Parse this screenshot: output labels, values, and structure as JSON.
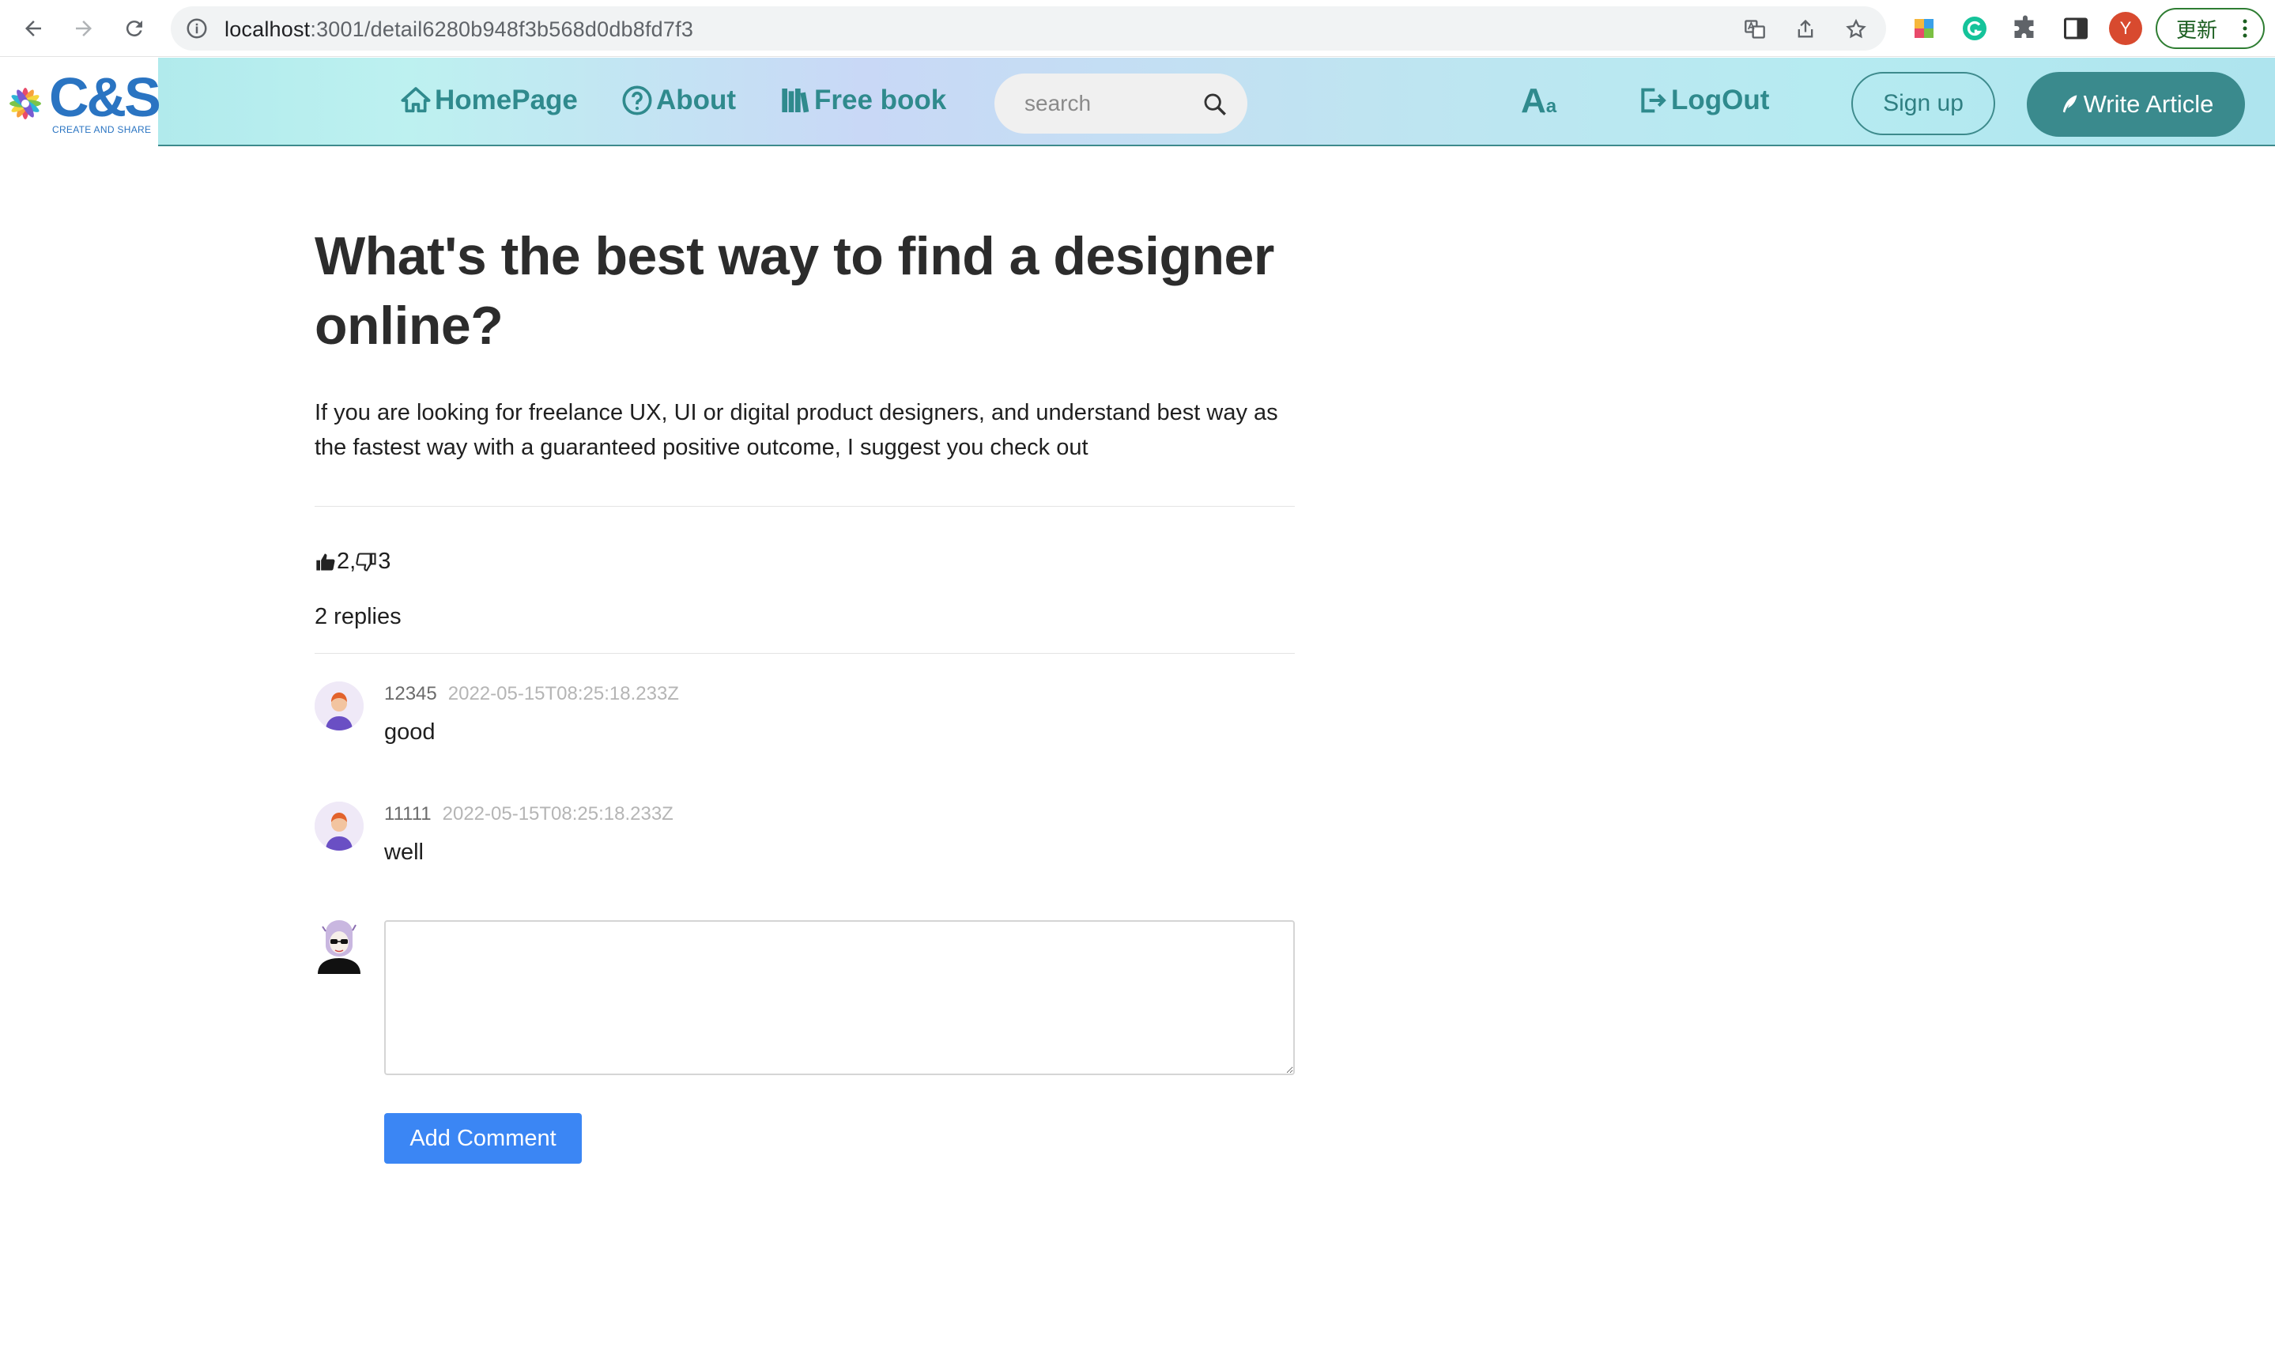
{
  "browser": {
    "url_host": "localhost",
    "url_path": ":3001/detail6280b948f3b568d0db8fd7f3",
    "profile_initial": "Y",
    "update_label": "更新"
  },
  "header": {
    "logo_text": "C&S",
    "logo_subtitle": "CREATE AND SHARE",
    "nav": [
      {
        "label": "HomePage",
        "icon": "home-icon"
      },
      {
        "label": "About",
        "icon": "question-circle-icon"
      },
      {
        "label": "Free book",
        "icon": "books-icon"
      }
    ],
    "search_placeholder": "search",
    "font_toggle_label": "A",
    "font_toggle_small": "a",
    "logout_label": "LogOut",
    "signup_label": "Sign up",
    "write_label": "Write Article",
    "accent_color": "#3a8a8d"
  },
  "article": {
    "title": "What's the best way to find a designer online?",
    "body": "If you are looking for freelance UX, UI or digital product designers, and understand best way as the fastest way with a guaranteed positive outcome, I suggest you check out",
    "likes": "2",
    "separator": ",",
    "dislikes": "3",
    "replies_label": "2 replies"
  },
  "comments": [
    {
      "author": "12345",
      "time": "2022-05-15T08:25:18.233Z",
      "text": "good"
    },
    {
      "author": "11111",
      "time": "2022-05-15T08:25:18.233Z",
      "text": "well"
    }
  ],
  "composer": {
    "value": "",
    "button_label": "Add Comment",
    "button_color": "#3b86f4"
  }
}
